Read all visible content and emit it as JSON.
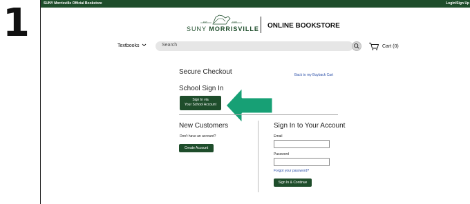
{
  "step_number": "1",
  "topbar": {
    "store_name": "SUNY Morrisville Official Bookstore",
    "login": "Login/Sign Up"
  },
  "header": {
    "logo_est": "EST.",
    "logo_year": "1908",
    "logo_suny": "SUNY",
    "logo_school": "MORRISVILLE",
    "store_title": "ONLINE BOOKSTORE"
  },
  "nav": {
    "textbooks_label": "Textbooks",
    "search_placeholder": "Search",
    "cart_label": "Cart (0)"
  },
  "checkout": {
    "title": "Secure Checkout",
    "back_link": "Back to my Buyback Cart",
    "school_heading": "School Sign In",
    "school_button_line1": "Sign In via",
    "school_button_line2": "Your School Account"
  },
  "new_customers": {
    "heading": "New Customers",
    "no_account": "Don't have an account?",
    "create_button": "Create Account"
  },
  "sign_in": {
    "heading": "Sign In to Your Account",
    "email_label": "Email",
    "email_value": "",
    "password_label": "Password",
    "password_value": "",
    "forgot_link": "Forgot your password?",
    "submit_button": "Sign In & Continue"
  },
  "colors": {
    "brand_green": "#1e4d2b",
    "arrow_green": "#17a075",
    "link_blue": "#2b4fa8"
  },
  "icons": {
    "search": "search-icon",
    "cart": "cart-icon",
    "chevron": "chevron-down-icon",
    "arrow": "arrow-left-icon"
  }
}
